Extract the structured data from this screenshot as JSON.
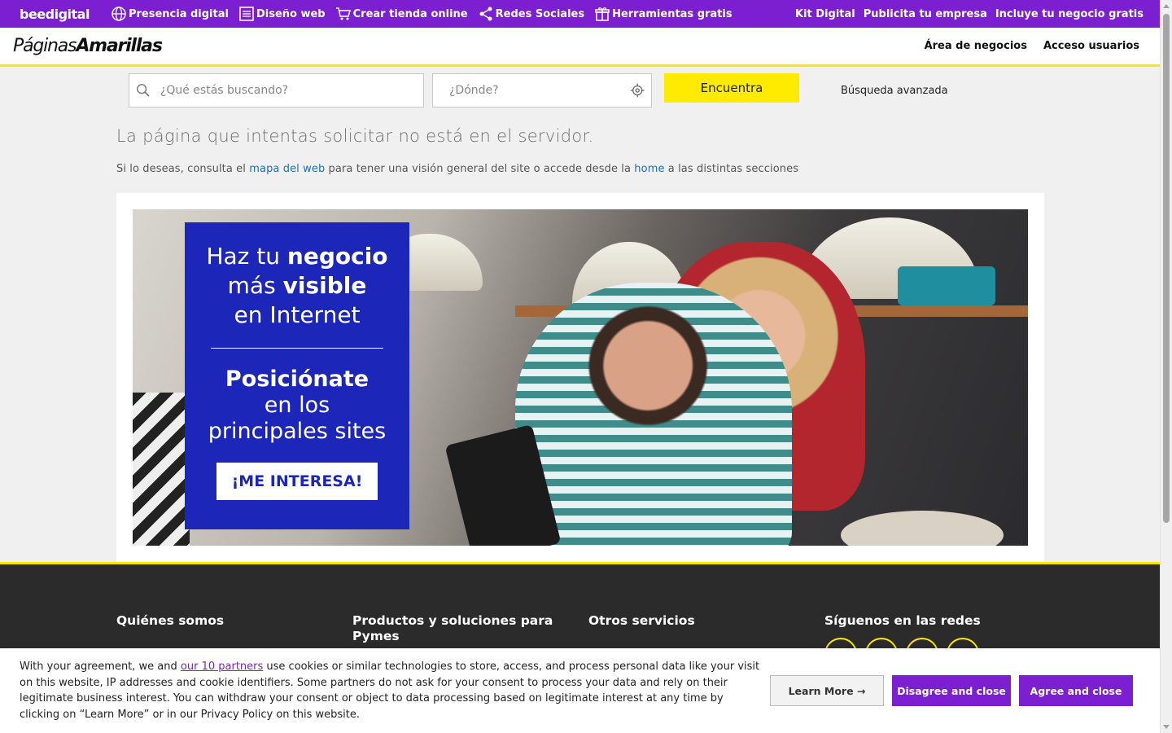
{
  "topbar": {
    "logo": "beedigital",
    "nav": [
      {
        "label": "Presencia digital",
        "icon": "globe-icon"
      },
      {
        "label": "Diseño web",
        "icon": "webpage-icon"
      },
      {
        "label": "Crear tienda online",
        "icon": "cart-icon"
      },
      {
        "label": "Redes Sociales",
        "icon": "share-icon"
      },
      {
        "label": "Herramientas gratis",
        "icon": "gift-icon"
      }
    ],
    "right": [
      "Kit Digital",
      "Publicita tu empresa",
      "Incluye tu negocio gratis"
    ]
  },
  "header": {
    "brand_light": "Páginas",
    "brand_bold": "Amarillas",
    "links": [
      "Área de negocios",
      "Acceso usuarios"
    ]
  },
  "search": {
    "what_placeholder": "¿Qué estás buscando?",
    "where_placeholder": "¿Dónde?",
    "button": "Encuentra",
    "advanced": "Búsqueda avanzada"
  },
  "error": {
    "title": "La página que intentas solicitar no está en el servidor.",
    "text_1": "Si lo deseas, consulta el ",
    "link_sitemap": "mapa del web",
    "text_2": " para tener una visión general del site o accede desde la ",
    "link_home": "home",
    "text_3": " a las distintas secciones"
  },
  "ad": {
    "line1_a": "Haz tu ",
    "line1_b": "negocio",
    "line2_a": "más ",
    "line2_b": "visible",
    "line3": "en Internet",
    "line4": "Posiciónate",
    "line5": "en los",
    "line6": "principales sites",
    "cta": "¡ME INTERESA!"
  },
  "footer": {
    "cols": [
      "Quiénes somos",
      "Productos y soluciones para Pymes",
      "Otros servicios",
      "Síguenos en las redes"
    ]
  },
  "cookie": {
    "text_1": "With your agreement, we and ",
    "partners_link": "our 10 partners",
    "text_2": " use cookies or similar technologies to store, access, and process personal data like your visit on this website, IP addresses and cookie identifiers. Some partners do not ask for your consent to process your data and rely on their legitimate business interest. You can withdraw your consent or object to data processing based on legitimate interest at any time by clicking on “Learn More” or in our Privacy Policy on this website.",
    "learn_more": "Learn More →",
    "disagree": "Disagree and close",
    "agree": "Agree and close"
  },
  "colors": {
    "brand_purple": "#7b1fd1",
    "brand_yellow": "#ffe500",
    "ad_blue": "#1c26b8",
    "footer_bg": "#2b2b2b"
  }
}
